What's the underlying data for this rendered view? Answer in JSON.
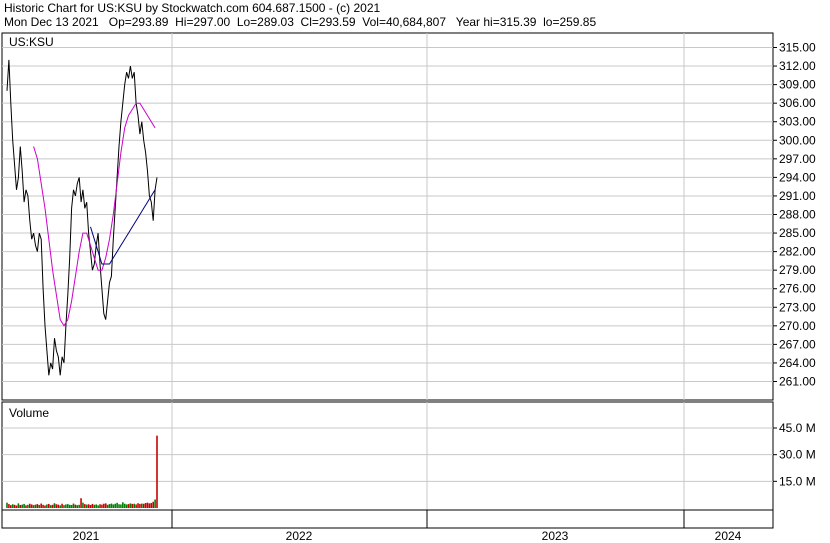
{
  "header": {
    "line1": "Historic Chart for US:KSU by Stockwatch.com 604.687.1500 - (c) 2021",
    "line2": "Mon Dec 13 2021   Op=293.89  Hi=297.00  Lo=289.03  Cl=293.59  Vol=40,684,807   Year hi=315.39  lo=259.85"
  },
  "colors": {
    "price": "#000000",
    "ma_short": "#cc00cc",
    "ma_long": "#000080",
    "volume_up": "#008000",
    "volume_down": "#cc0000",
    "grid": "#c8c8c8"
  },
  "chart_data": [
    {
      "type": "line",
      "title": "US:KSU",
      "ylim": [
        259,
        316
      ],
      "y_ticks": [
        "315.00",
        "312.00",
        "309.00",
        "306.00",
        "303.00",
        "300.00",
        "297.00",
        "294.00",
        "291.00",
        "288.00",
        "285.00",
        "282.00",
        "279.00",
        "276.00",
        "273.00",
        "270.00",
        "267.00",
        "264.00",
        "261.00"
      ],
      "x_period_labels": [
        "2021",
        "2022",
        "2023",
        "2024"
      ],
      "series": [
        {
          "role": "price",
          "x": [
            0,
            1,
            2,
            3,
            4,
            5,
            6,
            7,
            8,
            9,
            10,
            11,
            12,
            13,
            14,
            15,
            16,
            17,
            18,
            19,
            20,
            21,
            22,
            23,
            24,
            25,
            26,
            27,
            28,
            29,
            30,
            31,
            32,
            33,
            34,
            35,
            36,
            37,
            38,
            39,
            40,
            41,
            42,
            43,
            44,
            45,
            46,
            47,
            48,
            49,
            50,
            51,
            52,
            53,
            54,
            55,
            56,
            57,
            58,
            59,
            60,
            61,
            62,
            63,
            64,
            65,
            66,
            67,
            68,
            69,
            70,
            71,
            72,
            73,
            74,
            75,
            76,
            77,
            78,
            79
          ],
          "values": [
            308,
            313,
            306,
            300,
            296,
            292,
            294,
            299,
            295,
            290,
            292,
            291,
            287,
            284,
            285,
            283,
            282,
            285,
            284,
            276,
            270,
            266,
            262,
            264,
            263,
            268,
            266,
            265,
            262,
            265,
            264,
            270,
            275,
            281,
            289,
            292,
            291,
            293,
            294,
            290,
            292,
            289,
            290,
            285,
            282,
            279,
            280,
            283,
            285,
            280,
            276,
            272,
            271,
            274,
            277,
            278,
            284,
            289,
            294,
            299,
            303,
            306,
            309,
            311,
            310,
            312,
            310,
            311,
            306,
            304,
            301,
            303,
            300,
            298,
            295,
            291,
            290,
            287,
            292,
            294
          ]
        },
        {
          "role": "moving_average_short",
          "x": [
            14,
            16,
            18,
            20,
            22,
            24,
            26,
            28,
            30,
            32,
            34,
            36,
            38,
            40,
            42,
            44,
            46,
            48,
            50,
            52,
            54,
            56,
            58,
            60,
            62,
            64,
            66,
            68,
            70,
            72,
            74,
            76,
            78
          ],
          "values": [
            299,
            297,
            293,
            289,
            284,
            279,
            275,
            271,
            270,
            271,
            274,
            278,
            282,
            285,
            285,
            283,
            281,
            279,
            279,
            281,
            284,
            288,
            293,
            298,
            302,
            304,
            305,
            306,
            306,
            305,
            304,
            303,
            302
          ]
        },
        {
          "role": "moving_average_long",
          "x": [
            44,
            46,
            48,
            50,
            52,
            54,
            56,
            58,
            60,
            62,
            64,
            66,
            68,
            70,
            72,
            74,
            76,
            78
          ],
          "values": [
            286,
            284,
            282,
            280,
            280,
            280,
            281,
            282,
            283,
            284,
            285,
            286,
            287,
            288,
            289,
            290,
            291,
            292
          ]
        }
      ]
    },
    {
      "type": "bar",
      "title": "Volume",
      "ylim": [
        0,
        50
      ],
      "y_ticks": [
        "45.0 M",
        "30.0 M",
        "15.0 M"
      ],
      "values": [
        3.0,
        2.2,
        1.6,
        2.1,
        1.8,
        1.4,
        2.6,
        1.7,
        1.9,
        2.3,
        1.5,
        1.8,
        2.4,
        2.0,
        1.6,
        1.9,
        2.2,
        1.7,
        2.5,
        1.8,
        1.4,
        2.0,
        2.3,
        1.6,
        1.8,
        2.7,
        2.1,
        1.9,
        1.5,
        2.4,
        1.6,
        2.0,
        2.2,
        1.8,
        1.7,
        2.5,
        1.9,
        1.6,
        1.8,
        5.5,
        3.0,
        2.2,
        1.9,
        2.1,
        1.7,
        2.3,
        1.8,
        2.0,
        1.5,
        2.1,
        1.9,
        2.4,
        2.6,
        1.8,
        2.2,
        2.5,
        2.0,
        2.4,
        2.9,
        2.1,
        2.0,
        3.2,
        2.4,
        2.0,
        2.2,
        2.6,
        2.3,
        2.4,
        2.0,
        2.7,
        2.3,
        2.5,
        2.4,
        2.8,
        3.0,
        2.6,
        2.8,
        3.5,
        4.8,
        40.7
      ],
      "up": [
        1,
        0,
        0,
        1,
        0,
        0,
        1,
        0,
        1,
        1,
        0,
        1,
        0,
        0,
        1,
        1,
        0,
        1,
        0,
        0,
        0,
        1,
        0,
        1,
        0,
        1,
        0,
        0,
        1,
        0,
        1,
        1,
        1,
        1,
        1,
        1,
        0,
        1,
        1,
        0,
        1,
        0,
        1,
        0,
        0,
        0,
        1,
        1,
        1,
        0,
        0,
        0,
        0,
        1,
        1,
        1,
        1,
        1,
        1,
        1,
        1,
        1,
        1,
        1,
        0,
        1,
        0,
        1,
        0,
        0,
        0,
        1,
        0,
        0,
        0,
        0,
        0,
        0,
        1,
        0
      ]
    }
  ]
}
